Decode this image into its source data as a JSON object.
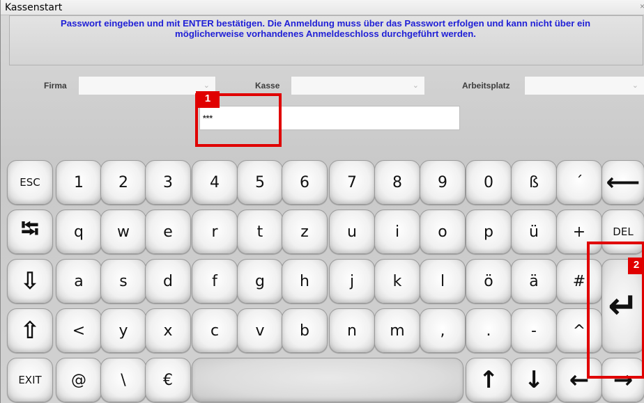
{
  "window": {
    "title": "Kassenstart",
    "close_glyph": "×"
  },
  "banner": {
    "line1": "Passwort eingeben und mit ENTER bestätigen. Die Anmeldung muss über das Passwort erfolgen und kann nicht über ein",
    "line2": "möglicherweise vorhandenes Anmeldeschloss durchgeführt werden."
  },
  "fields": {
    "firma_label": "Firma",
    "kasse_label": "Kasse",
    "arbeitsplatz_label": "Arbeitsplatz",
    "password_value": "***"
  },
  "highlights": {
    "one": "1",
    "two": "2"
  },
  "keyboard": {
    "row1": [
      "ESC",
      "1",
      "2",
      "3",
      "4",
      "5",
      "6",
      "7",
      "8",
      "9",
      "0",
      "ß",
      "´",
      "⟵"
    ],
    "row2": [
      "⭾",
      "q",
      "w",
      "e",
      "r",
      "t",
      "z",
      "u",
      "i",
      "o",
      "p",
      "ü",
      "+",
      "DEL"
    ],
    "row3": [
      "⇩",
      "a",
      "s",
      "d",
      "f",
      "g",
      "h",
      "j",
      "k",
      "l",
      "ö",
      "ä",
      "#"
    ],
    "row4": [
      "⇧",
      "<",
      "y",
      "x",
      "c",
      "v",
      "b",
      "n",
      "m",
      ",",
      ".",
      "-",
      "^"
    ],
    "row5": [
      "EXIT",
      "@",
      "\\",
      "€",
      "↑",
      "↓",
      "←",
      "→"
    ],
    "enter": "↵"
  }
}
